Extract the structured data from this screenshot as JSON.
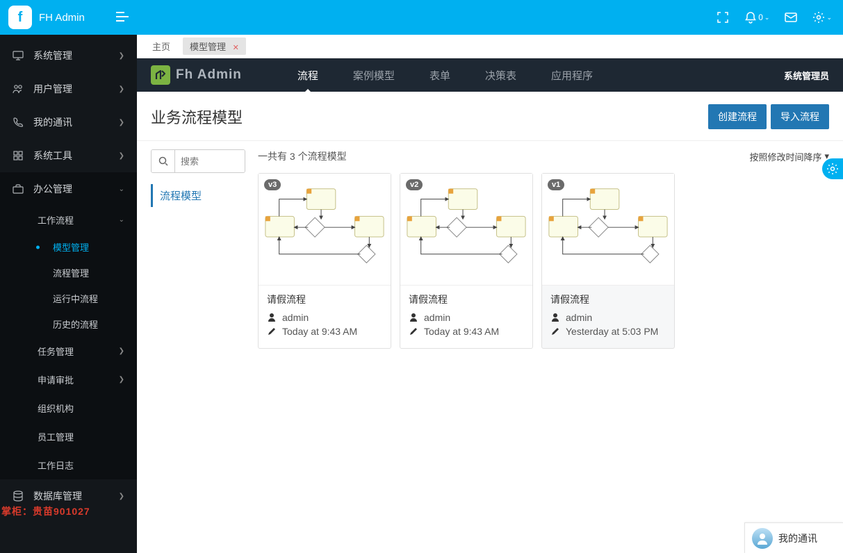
{
  "app": {
    "title": "FH Admin"
  },
  "sidebar": {
    "items": [
      {
        "label": "系统管理"
      },
      {
        "label": "用户管理"
      },
      {
        "label": "我的通讯"
      },
      {
        "label": "系统工具"
      },
      {
        "label": "办公管理"
      },
      {
        "label": "数据库管理"
      }
    ],
    "office_sub": {
      "workflow": {
        "label": "工作流程"
      },
      "workflow_items": [
        {
          "label": "模型管理"
        },
        {
          "label": "流程管理"
        },
        {
          "label": "运行中流程"
        },
        {
          "label": "历史的流程"
        }
      ],
      "others": [
        {
          "label": "任务管理"
        },
        {
          "label": "申请审批"
        },
        {
          "label": "组织机构"
        },
        {
          "label": "员工管理"
        },
        {
          "label": "工作日志"
        }
      ]
    }
  },
  "watermark": "掌柜：贵苗901027",
  "top_icons": {
    "notif_badge": "0"
  },
  "tabs": {
    "home": "主页",
    "active": "模型管理"
  },
  "inner": {
    "logo_text": "Fh Admin",
    "nav": [
      {
        "label": "流程"
      },
      {
        "label": "案例模型"
      },
      {
        "label": "表单"
      },
      {
        "label": "决策表"
      },
      {
        "label": "应用程序"
      }
    ],
    "user": "系统管理员"
  },
  "page": {
    "title": "业务流程模型",
    "btn_create": "创建流程",
    "btn_import": "导入流程"
  },
  "search": {
    "placeholder": "搜索"
  },
  "filter": {
    "label": "流程模型"
  },
  "toolbar": {
    "count_text": "一共有 3 个流程模型",
    "sort_label": "按照修改时间降序"
  },
  "cards": [
    {
      "version": "v3",
      "title": "请假流程",
      "owner": "admin",
      "time": "Today at 9:43 AM"
    },
    {
      "version": "v2",
      "title": "请假流程",
      "owner": "admin",
      "time": "Today at 9:43 AM"
    },
    {
      "version": "v1",
      "title": "请假流程",
      "owner": "admin",
      "time": "Yesterday at 5:03 PM"
    }
  ],
  "chat": {
    "label": "我的通讯"
  }
}
